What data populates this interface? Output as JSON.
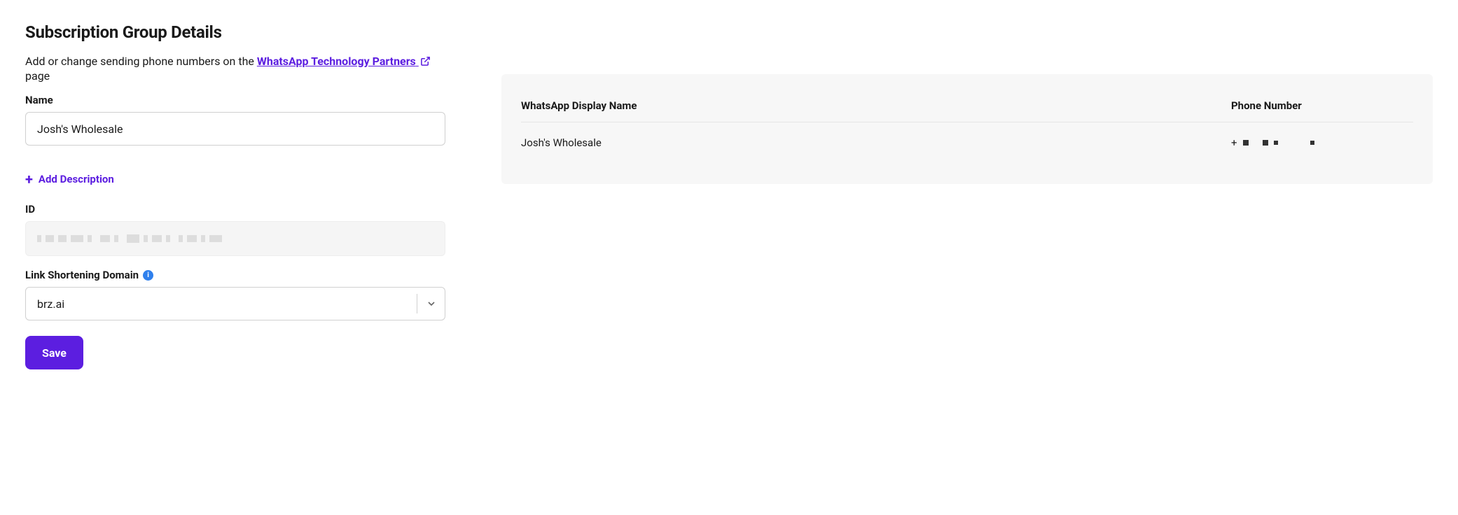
{
  "heading": "Subscription Group Details",
  "subtitle_prefix": "Add or change sending phone numbers on the ",
  "subtitle_link": "WhatsApp Technology Partners",
  "subtitle_suffix": " page",
  "labels": {
    "name": "Name",
    "id": "ID",
    "link_domain": "Link Shortening Domain"
  },
  "fields": {
    "name_value": "Josh's Wholesale",
    "link_domain_value": "brz.ai"
  },
  "buttons": {
    "add_description": "Add Description",
    "save": "Save"
  },
  "table": {
    "col_display_name": "WhatsApp Display Name",
    "col_phone": "Phone Number",
    "rows": [
      {
        "display_name": "Josh's Wholesale",
        "phone_prefix": "+"
      }
    ]
  }
}
